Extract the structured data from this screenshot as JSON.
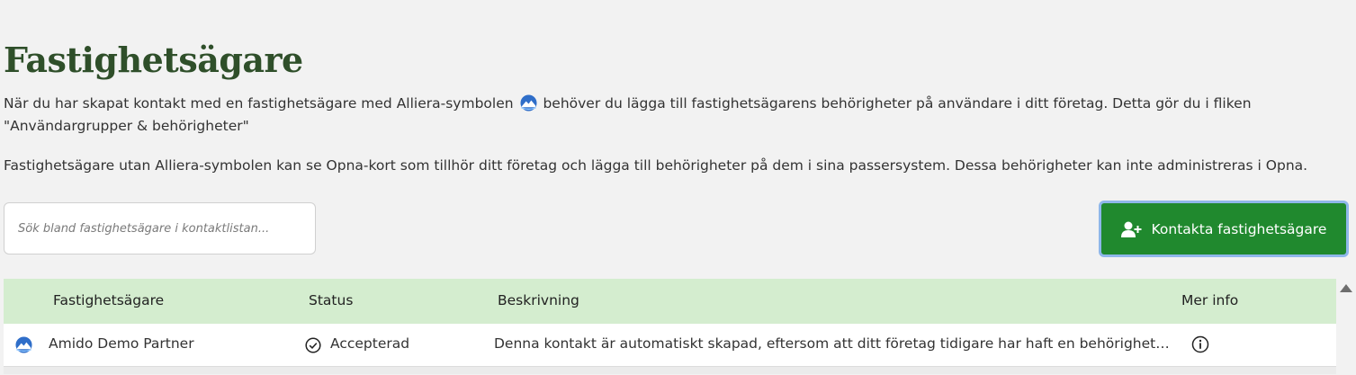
{
  "page": {
    "title": "Fastighetsägare",
    "intro_before_icon": "När du har skapat kontakt med en fastighetsägare med Alliera-symbolen",
    "intro_after_icon": "behöver du lägga till fastighetsägarens behörigheter på användare i ditt företag. Detta gör du i fliken \"Användargrupper & behörigheter\"",
    "info_text": "Fastighetsägare utan Alliera-symbolen kan se Opna-kort som tillhör ditt företag och lägga till behörigheter på dem i sina passersystem. Dessa behörigheter kan inte administreras i Opna."
  },
  "search": {
    "placeholder": "Sök bland fastighetsägare i kontaktlistan...",
    "value": ""
  },
  "actions": {
    "contact_button_label": "Kontakta fastighetsägare",
    "contact_button_icon": "user-plus-icon"
  },
  "table": {
    "headers": {
      "owner": "Fastighetsägare",
      "status": "Status",
      "description": "Beskrivning",
      "more_info": "Mer info"
    },
    "rows": [
      {
        "icon": "alliera-icon",
        "owner": "Amido Demo Partner",
        "status_icon": "check-circle-icon",
        "status": "Accepterad",
        "description": "Denna kontakt är automatiskt skapad, eftersom att ditt företag tidigare har haft en behörighet hos denna fastighetsägare.",
        "info_icon": "info-icon"
      }
    ]
  },
  "colors": {
    "title": "#2f4f2a",
    "primary_button": "#20892e",
    "button_focus_ring": "#8fb7ea",
    "table_header": "#d4edcf",
    "background": "#f2f2f2",
    "alliera_blue": "#2f6ec9"
  }
}
